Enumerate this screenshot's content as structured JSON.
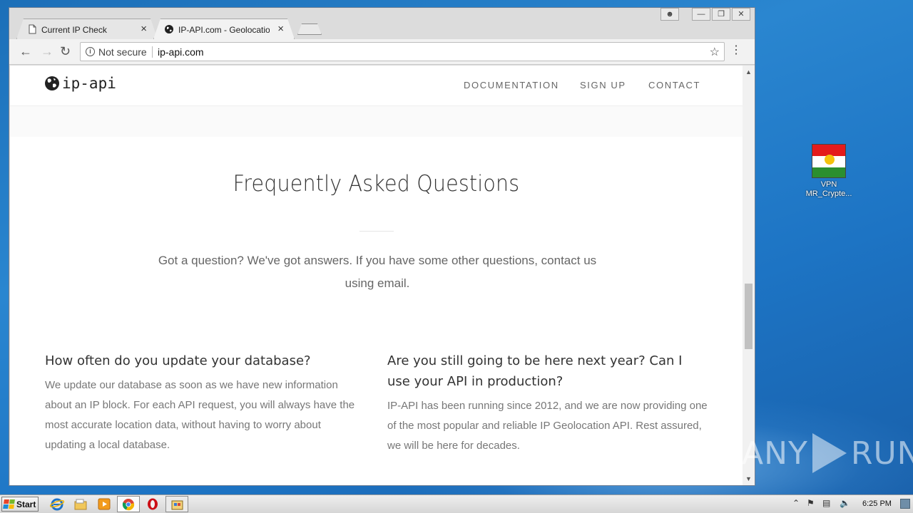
{
  "browser": {
    "tabs": [
      {
        "title": "Current IP Check",
        "icon": "page-icon",
        "active": false
      },
      {
        "title": "IP-API.com - Geolocation API",
        "icon": "globe-icon",
        "active": true
      }
    ],
    "omnibox": {
      "security_label": "Not secure",
      "url": "ip-api.com"
    }
  },
  "site": {
    "logo_text": "ip-api",
    "nav": [
      "DOCUMENTATION",
      "SIGN UP",
      "CONTACT"
    ]
  },
  "faq": {
    "title": "Frequently Asked Questions",
    "intro": "Got a question? We've got answers. If you have some other questions, contact us using email.",
    "items": [
      {
        "question": "How often do you update your database?",
        "answer": "We update our database as soon as we have new information about an IP block. For each API request, you will always have the most accurate location data, without having to worry about updating a local database."
      },
      {
        "question": "Are you still going to be here next year? Can I use your API in production?",
        "answer": "IP-API has been running since 2012, and we are now providing one of the most popular and reliable IP Geolocation API. Rest assured, we will be here for decades."
      }
    ]
  },
  "desktop": {
    "icon_label": "VPN\nMR_Crypte..."
  },
  "watermark": {
    "left": "ANY",
    "right": "RUN"
  },
  "taskbar": {
    "start_label": "Start",
    "clock": "6:25 PM"
  }
}
